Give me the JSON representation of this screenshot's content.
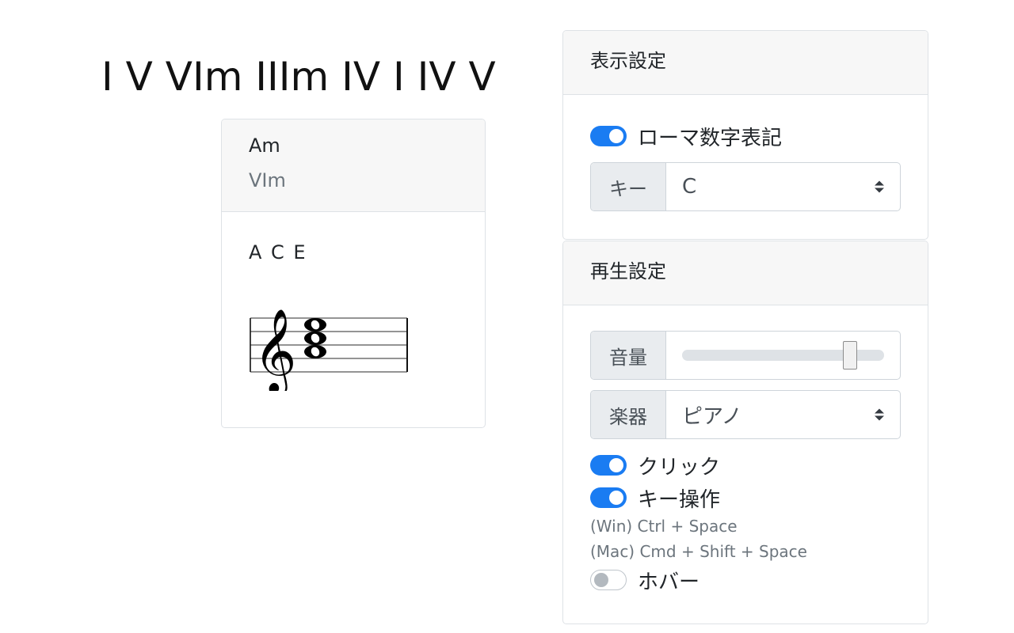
{
  "progression": "I V VIm IIIm IV I IV V",
  "chord_card": {
    "name": "Am",
    "roman": "VIm",
    "notes": "A C E"
  },
  "display_settings": {
    "title": "表示設定",
    "roman_toggle": {
      "label": "ローマ数字表記",
      "on": true
    },
    "key": {
      "label": "キー",
      "value": "C"
    }
  },
  "playback_settings": {
    "title": "再生設定",
    "volume": {
      "label": "音量",
      "value": 0.83
    },
    "instrument": {
      "label": "楽器",
      "value": "ピアノ"
    },
    "click_toggle": {
      "label": "クリック",
      "on": true
    },
    "keyboard_toggle": {
      "label": "キー操作",
      "on": true
    },
    "shortcut_win": "(Win) Ctrl + Space",
    "shortcut_mac": "(Mac) Cmd + Shift + Space",
    "hover_toggle": {
      "label": "ホバー",
      "on": false
    }
  },
  "colors": {
    "accent": "#1a7cf2",
    "card_header_bg": "#f7f7f7",
    "border": "#dee2e6",
    "muted_text": "#6c757d"
  }
}
